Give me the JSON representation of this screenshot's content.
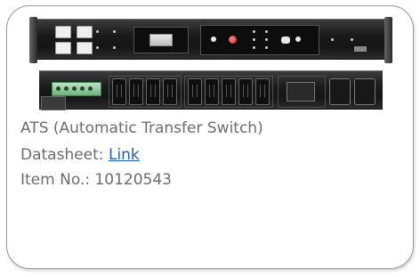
{
  "product": {
    "title": "ATS (Automatic Transfer Switch)",
    "datasheet_label": "Datasheet: ",
    "datasheet_link_text": "Link",
    "item_no_label": "Item No.: ",
    "item_no_value": "10120543"
  },
  "images": {
    "front_view": "ats-front-panel-photo",
    "rear_view": "ats-rear-panel-photo"
  },
  "colors": {
    "text": "#6c6c6c",
    "link": "#1f5fb5",
    "card_border": "#9a9a9a"
  }
}
